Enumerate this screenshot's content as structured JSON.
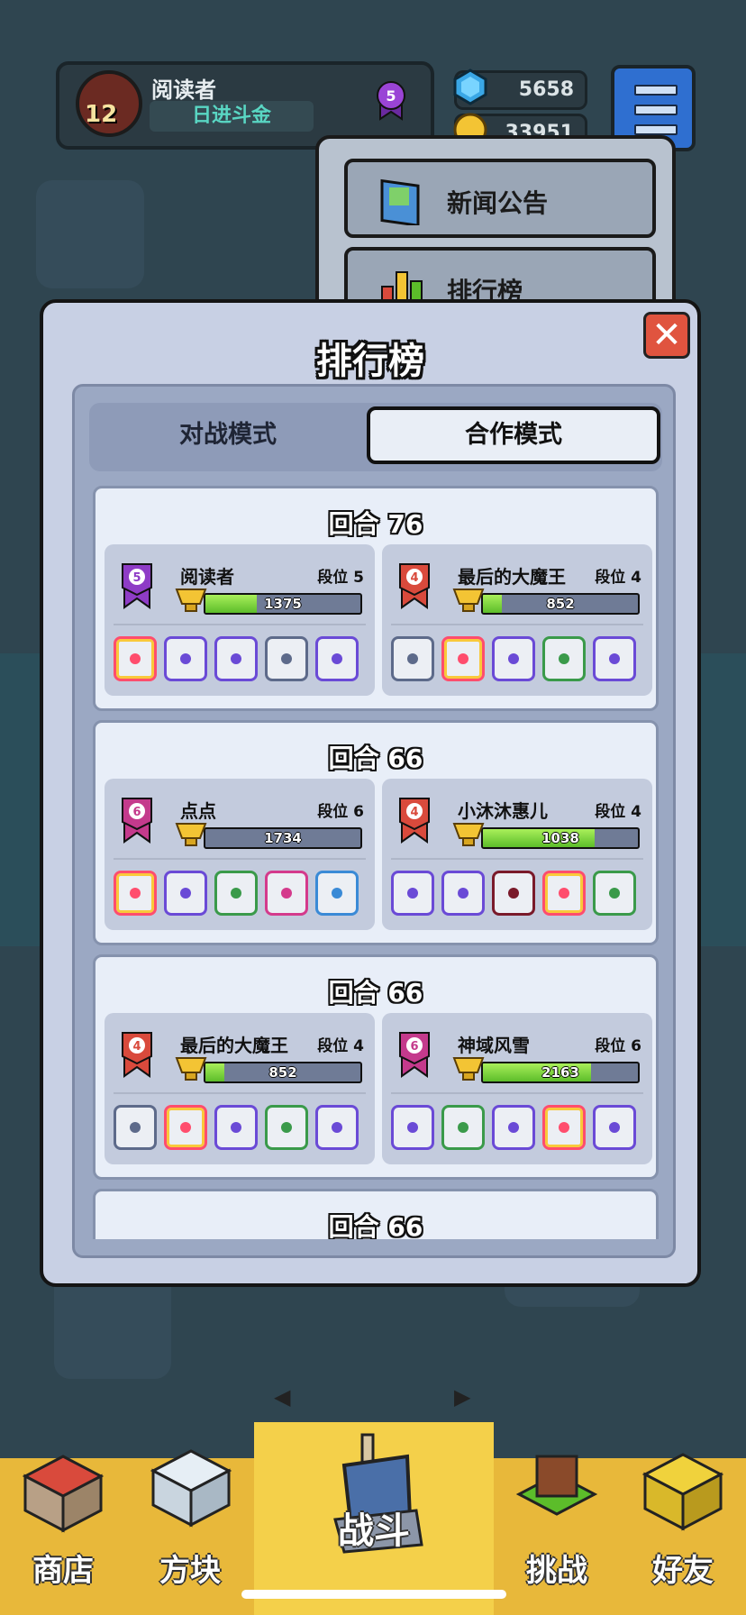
{
  "hud": {
    "player_name": "阅读者",
    "player_title": "日进斗金",
    "level": "12",
    "rank_badge": "5",
    "gems": "5658",
    "coins": "33951"
  },
  "dropdown": {
    "items": [
      {
        "label": "新闻公告",
        "icon": "news-icon"
      },
      {
        "label": "排行榜",
        "icon": "chart-icon"
      }
    ]
  },
  "modal": {
    "title": "排行榜",
    "close_label": "✕",
    "tabs": [
      {
        "label": "对战模式",
        "active": false
      },
      {
        "label": "合作模式",
        "active": true
      }
    ],
    "rank_prefix": "段位",
    "entries": [
      {
        "round_label": "回合",
        "round_value": "76",
        "players": [
          {
            "name": "阅读者",
            "rank": "5",
            "ribbon_color": "#8e3cc6",
            "score": "1375",
            "progress": 0.33,
            "dice": [
              "rainbow",
              "purple",
              "combo",
              "grey",
              "combo"
            ]
          },
          {
            "name": "最后的大魔王",
            "rank": "4",
            "ribbon_color": "#d94a3c",
            "score": "852",
            "progress": 0.12,
            "dice": [
              "grey",
              "rainbow",
              "combo",
              "green",
              "purple"
            ]
          }
        ]
      },
      {
        "round_label": "回合",
        "round_value": "66",
        "players": [
          {
            "name": "点点",
            "rank": "6",
            "ribbon_color": "#c43a8c",
            "score": "1734",
            "progress": 0.0,
            "dice": [
              "rainbow",
              "purple",
              "green",
              "pink",
              "blue"
            ]
          },
          {
            "name": "小沐沐惠儿",
            "rank": "4",
            "ribbon_color": "#d94a3c",
            "score": "1038",
            "progress": 0.72,
            "dice": [
              "combo",
              "purple",
              "dark",
              "rainbow",
              "green"
            ]
          }
        ]
      },
      {
        "round_label": "回合",
        "round_value": "66",
        "players": [
          {
            "name": "最后的大魔王",
            "rank": "4",
            "ribbon_color": "#d94a3c",
            "score": "852",
            "progress": 0.12,
            "dice": [
              "grey",
              "rainbow",
              "combo",
              "green",
              "purple"
            ]
          },
          {
            "name": "神域风雪",
            "rank": "6",
            "ribbon_color": "#c43a8c",
            "score": "2163",
            "progress": 0.7,
            "dice": [
              "combo",
              "green",
              "combo",
              "rainbow",
              "purple"
            ]
          }
        ]
      },
      {
        "round_label": "回合",
        "round_value": "66",
        "players": []
      }
    ]
  },
  "bottom_nav": [
    {
      "label": "商店",
      "icon": "shop-icon"
    },
    {
      "label": "方块",
      "icon": "dice-box-icon"
    },
    {
      "label": "战斗",
      "icon": "battle-icon"
    },
    {
      "label": "挑战",
      "icon": "challenge-icon"
    },
    {
      "label": "好友",
      "icon": "friend-icon"
    }
  ],
  "colors": {
    "accent_green": "#5cbd2a",
    "modal_bg": "#c8d0e4",
    "nav_yellow": "#e8b83a",
    "close_red": "#e0543f"
  }
}
